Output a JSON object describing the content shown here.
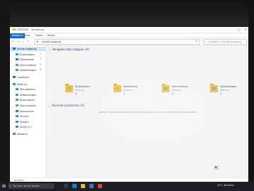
{
  "window": {
    "title": "Verkenner",
    "file_tab": "Bestand",
    "tabs": [
      "Start",
      "Delen",
      "Beeld"
    ]
  },
  "address": {
    "path": "Snelle toegang",
    "search_placeholder": "Zoeken in Snelle toegang"
  },
  "sidebar": {
    "items": [
      {
        "label": "Snelle toegang",
        "icon": "star-icon",
        "color": "#1a6fc9",
        "selected": true,
        "pinned": false,
        "child": false
      },
      {
        "label": "Bureaublad",
        "icon": "desktop-icon",
        "color": "#3a8ee6",
        "selected": false,
        "pinned": true,
        "child": true
      },
      {
        "label": "Downloads",
        "icon": "download-icon",
        "color": "#2f7bd6",
        "selected": false,
        "pinned": true,
        "child": true
      },
      {
        "label": "Documenten",
        "icon": "document-icon",
        "color": "#8a8a8a",
        "selected": false,
        "pinned": true,
        "child": true
      },
      {
        "label": "Afbeeldingen",
        "icon": "image-icon",
        "color": "#3a8ee6",
        "selected": false,
        "pinned": true,
        "child": true
      },
      {
        "label": "OneDrive",
        "icon": "cloud-icon",
        "color": "#1a6fc9",
        "selected": false,
        "pinned": false,
        "child": false
      },
      {
        "label": "Deze pc",
        "icon": "computer-icon",
        "color": "#3a8ee6",
        "selected": false,
        "pinned": false,
        "child": false
      },
      {
        "label": "3D-objecten",
        "icon": "cube-icon",
        "color": "#3a8ee6",
        "selected": false,
        "pinned": false,
        "child": true
      },
      {
        "label": "Afbeeldingen",
        "icon": "image-icon",
        "color": "#3a8ee6",
        "selected": false,
        "pinned": false,
        "child": true
      },
      {
        "label": "Bureaublad",
        "icon": "desktop-icon",
        "color": "#3a8ee6",
        "selected": false,
        "pinned": false,
        "child": true
      },
      {
        "label": "Documenten",
        "icon": "document-icon",
        "color": "#8a8a8a",
        "selected": false,
        "pinned": false,
        "child": true
      },
      {
        "label": "Downloads",
        "icon": "download-icon",
        "color": "#2f7bd6",
        "selected": false,
        "pinned": false,
        "child": true
      },
      {
        "label": "Muziek",
        "icon": "music-icon",
        "color": "#3a8ee6",
        "selected": false,
        "pinned": false,
        "child": true
      },
      {
        "label": "Video's",
        "icon": "video-icon",
        "color": "#3a8ee6",
        "selected": false,
        "pinned": false,
        "child": true
      },
      {
        "label": "Schijf (C:)",
        "icon": "drive-icon",
        "color": "#7a7a7a",
        "selected": false,
        "pinned": false,
        "child": true
      },
      {
        "label": "Netwerk",
        "icon": "network-icon",
        "color": "#3a8ee6",
        "selected": false,
        "pinned": false,
        "child": false
      }
    ]
  },
  "main": {
    "frequent_header": "Veelgebruikte mappen (4)",
    "folders": [
      {
        "name": "Bureaublad",
        "sub": "Deze pc",
        "glyph": "▭",
        "icon": "desktop-folder-icon"
      },
      {
        "name": "Downloads",
        "sub": "Deze pc",
        "glyph": "↓",
        "icon": "downloads-folder-icon"
      },
      {
        "name": "Documenten",
        "sub": "Deze pc",
        "glyph": "▤",
        "icon": "documents-folder-icon"
      },
      {
        "name": "Afbeeldingen",
        "sub": "Deze pc",
        "glyph": "▨",
        "icon": "pictures-folder-icon"
      }
    ],
    "recent_header": "Recente bestanden (0)",
    "empty_message": "Nadat u een aantal bestanden hebt geopend, ziet u hier de meest recente items."
  },
  "status": {
    "items": "8 items"
  },
  "taskbar": {
    "search_placeholder": "Typ hier om te zoeken",
    "tray_text": "10°C Bewolkt"
  }
}
